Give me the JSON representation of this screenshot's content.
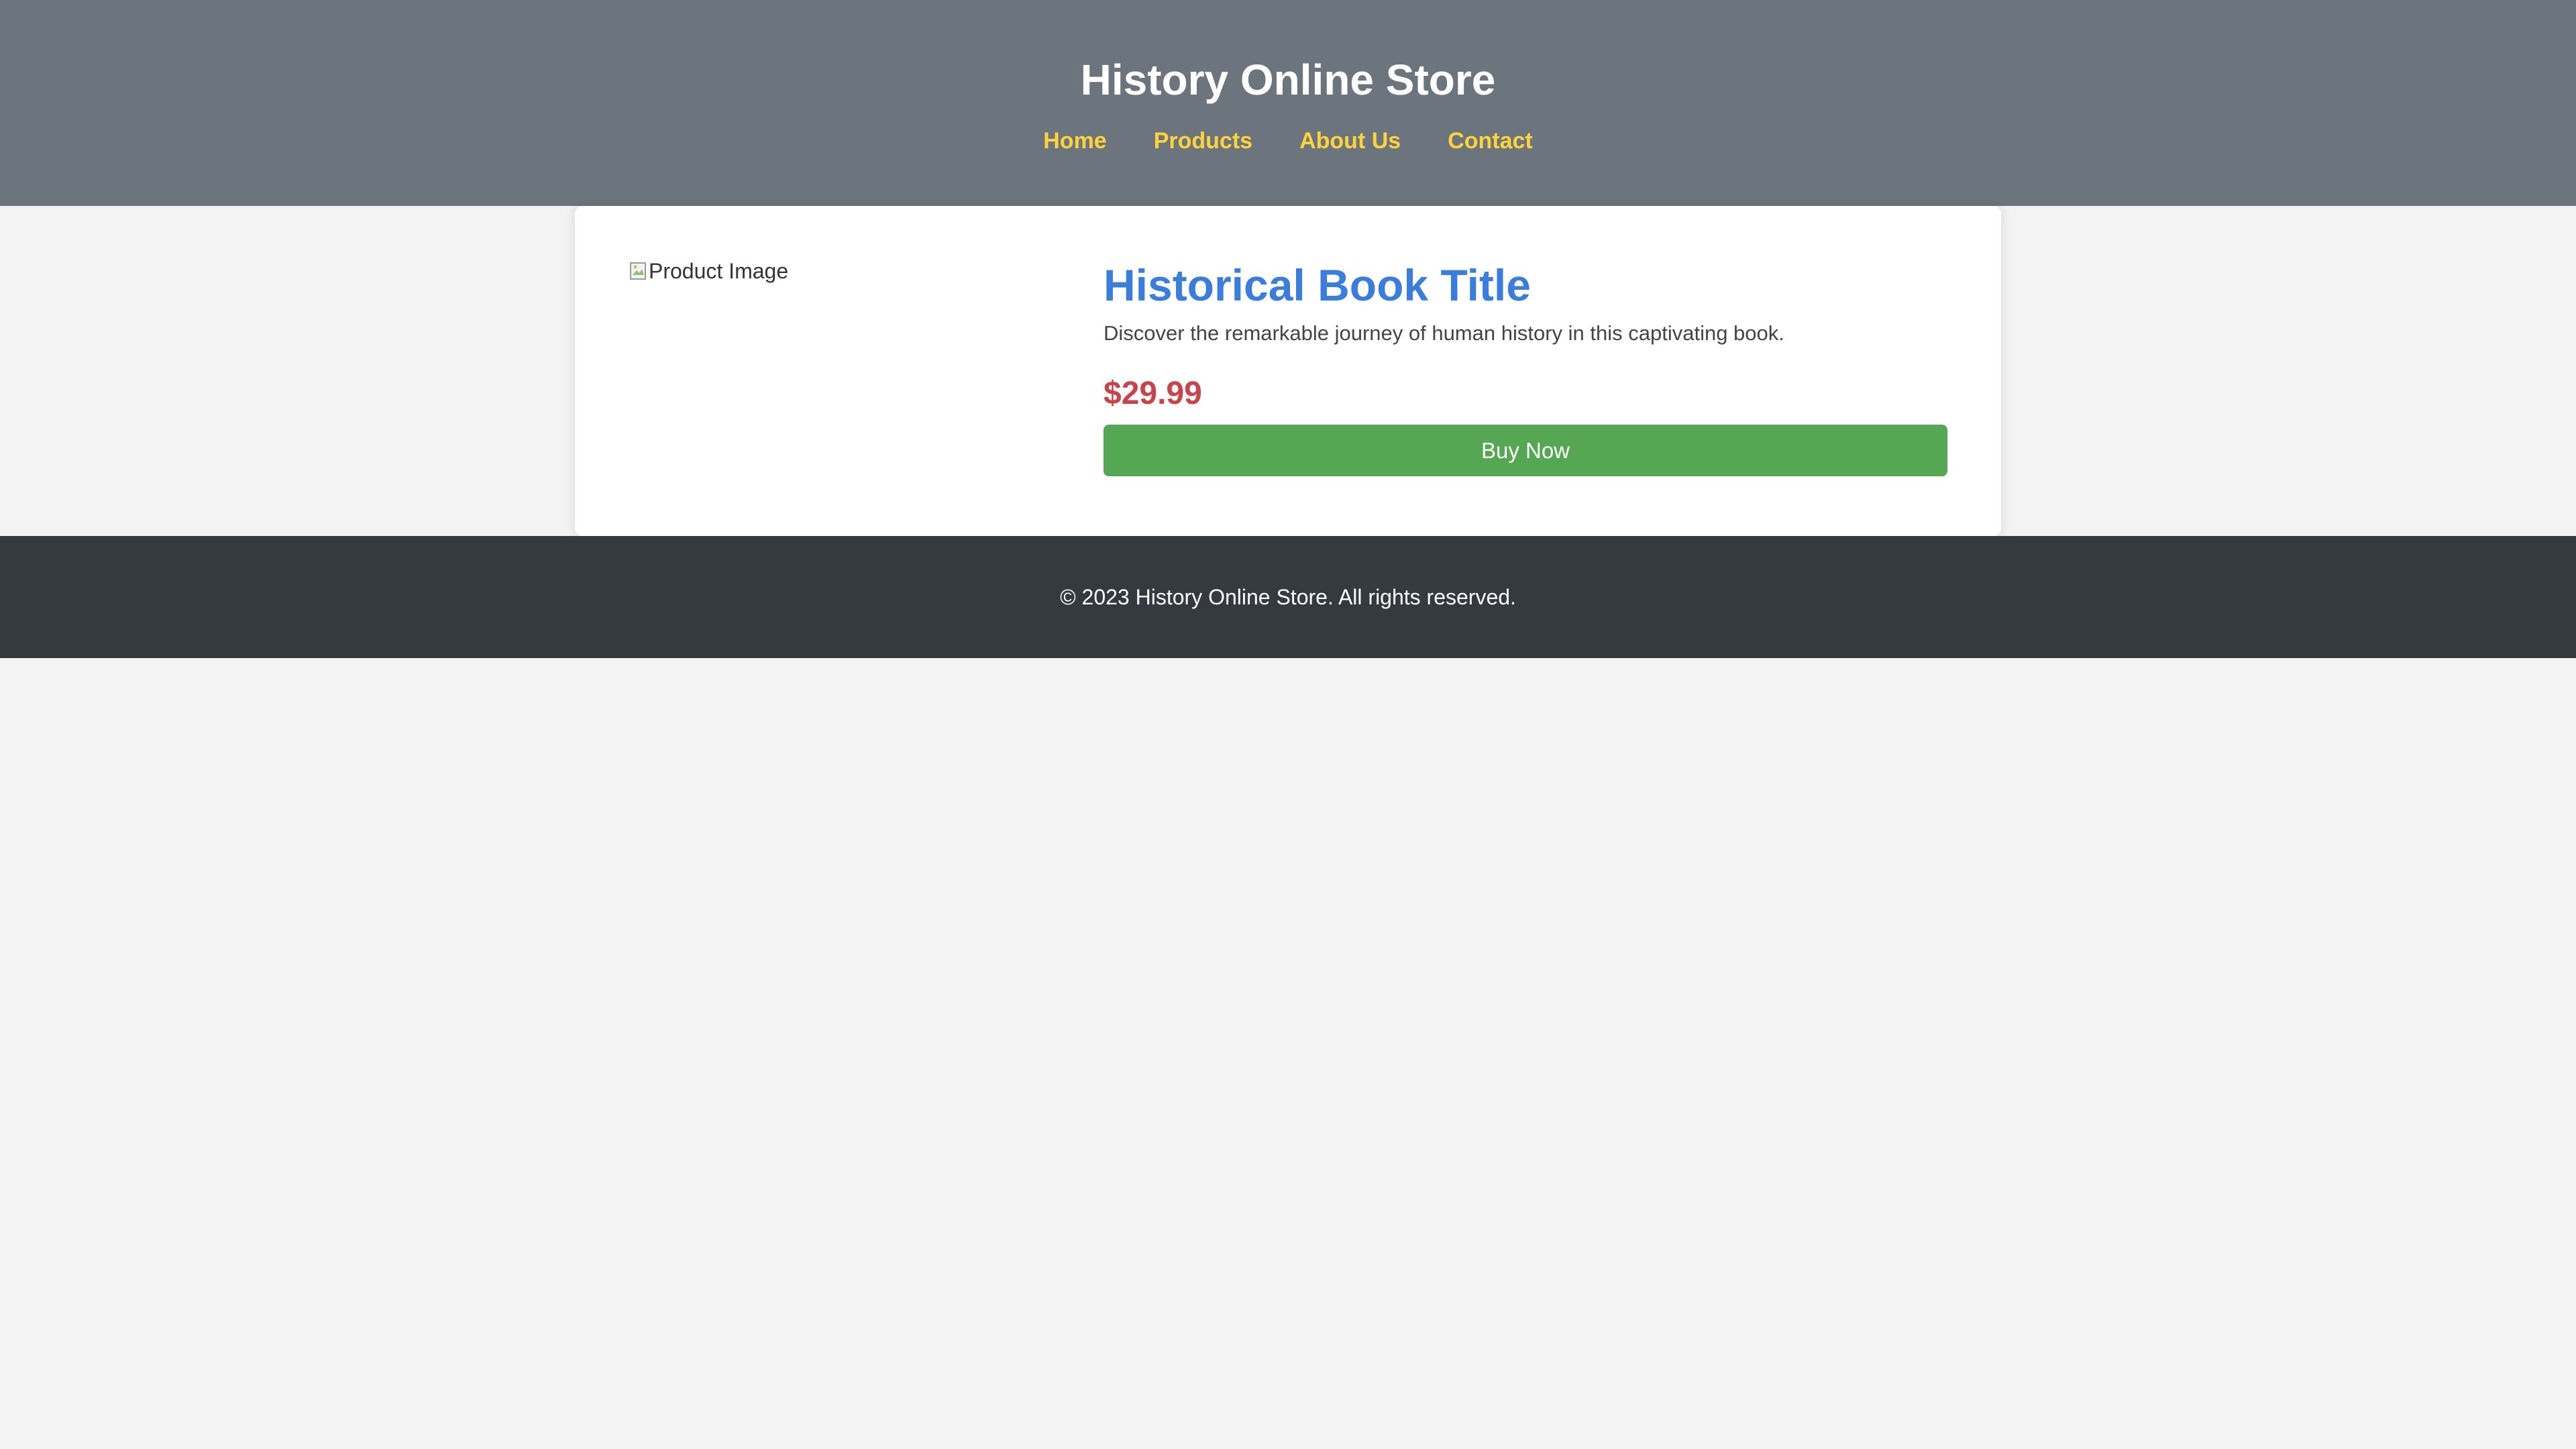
{
  "header": {
    "title": "History Online Store",
    "nav": [
      {
        "label": "Home"
      },
      {
        "label": "Products"
      },
      {
        "label": "About Us"
      },
      {
        "label": "Contact"
      }
    ]
  },
  "product": {
    "image_alt": "Product Image",
    "title": "Historical Book Title",
    "description": "Discover the remarkable journey of human history in this captivating book.",
    "price": "$29.99",
    "buy_label": "Buy Now"
  },
  "footer": {
    "text": "© 2023 History Online Store. All rights reserved."
  },
  "colors": {
    "header_bg": "#6c757d",
    "nav_link": "#ffd43b",
    "title_blue": "#3b7ddd",
    "price_red": "#c9434b",
    "button_green": "#55a753",
    "footer_bg": "#343a40",
    "page_bg": "#f3f3f3"
  },
  "icons": {
    "image_placeholder": "broken-image-icon"
  }
}
